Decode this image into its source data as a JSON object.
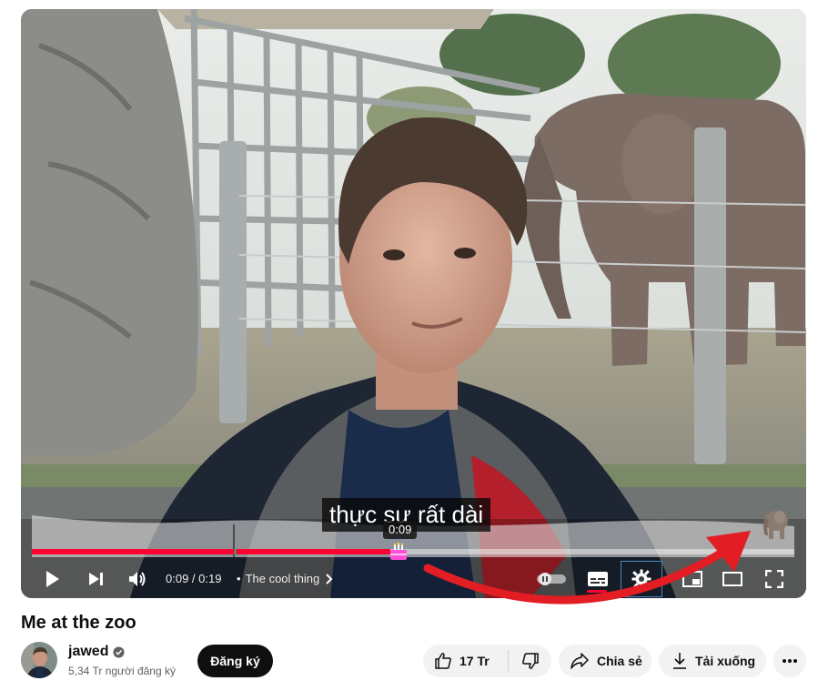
{
  "player": {
    "subtitle": "thực sự rất dài",
    "hover_time": "0:09",
    "current_time": "0:09",
    "duration": "0:19",
    "time_separator": " / ",
    "chapter_bullet": "•",
    "chapter_title": "The cool thing",
    "progress_played_fraction": 0.47,
    "progress_hover_fraction": 0.47,
    "accent_color": "#ff0033",
    "icons": [
      "play-icon",
      "next-icon",
      "volume-icon",
      "autoplay-toggle",
      "subtitles-icon",
      "settings-icon",
      "miniplayer-icon",
      "theater-icon",
      "fullscreen-icon",
      "elephant-icon",
      "cake-icon"
    ]
  },
  "video": {
    "title": "Me at the zoo"
  },
  "channel": {
    "name": "jawed",
    "subscribers": "5,34 Tr người đăng ký",
    "verified": true
  },
  "actions": {
    "subscribe": "Đăng ký",
    "likes": "17 Tr",
    "share": "Chia sẻ",
    "download": "Tải xuống"
  }
}
